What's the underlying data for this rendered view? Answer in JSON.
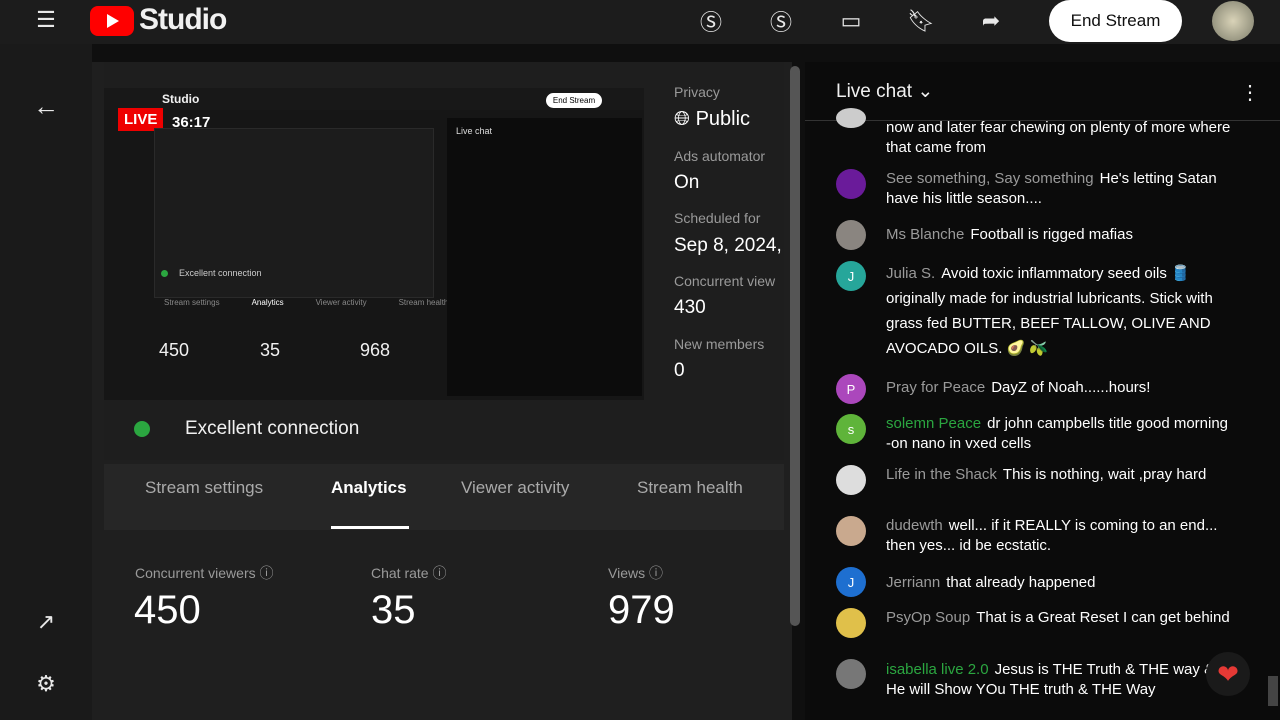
{
  "header": {
    "logo_text": "Studio",
    "end_stream": "End Stream",
    "icons": [
      "menu-icon",
      "youtube-logo",
      "super-chat-icon",
      "super-thanks-icon",
      "clapperboard-icon",
      "bookmark-icon",
      "share-icon"
    ]
  },
  "preview": {
    "live_badge": "LIVE",
    "elapsed": "36:17",
    "inner_logo": "Studio",
    "inner_end": "End Stream",
    "inner_chat_title": "Live chat",
    "inner_connection": "Excellent connection",
    "inner_tabs": [
      "Stream settings",
      "Analytics",
      "Viewer activity",
      "Stream health"
    ],
    "inner_stats": [
      "450",
      "35",
      "968"
    ]
  },
  "connection": {
    "status": "Excellent connection",
    "color": "#2ba640"
  },
  "details": {
    "privacy_label": "Privacy",
    "privacy_value": "Public",
    "ads_label": "Ads automator",
    "ads_value": "On",
    "scheduled_label": "Scheduled for",
    "scheduled_value": "Sep 8, 2024,",
    "concurrent_label": "Concurrent view",
    "concurrent_value": "430",
    "members_label": "New members",
    "members_value": "0"
  },
  "tabs": [
    {
      "label": "Stream settings"
    },
    {
      "label": "Analytics",
      "active": true
    },
    {
      "label": "Viewer activity"
    },
    {
      "label": "Stream health"
    }
  ],
  "stats": [
    {
      "label": "Concurrent viewers",
      "value": "450"
    },
    {
      "label": "Chat rate",
      "value": "35"
    },
    {
      "label": "Views",
      "value": "979"
    }
  ],
  "chat": {
    "title": "Live chat",
    "messages": [
      {
        "author": "",
        "text": "now and later fear chewing on plenty of more where that came from"
      },
      {
        "author": "See something, Say something",
        "text": "He's letting Satan have his little season...."
      },
      {
        "author": "Ms Blanche",
        "text": "Football is rigged mafias"
      },
      {
        "author": "Julia S.",
        "text": "Avoid toxic inflammatory seed oils 🛢️ originally made for industrial lubricants. Stick with grass fed BUTTER, BEEF TALLOW, OLIVE AND AVOCADO OILS. 🥑 🫒",
        "initial": "J"
      },
      {
        "author": "Pray for Peace",
        "text": "DayZ of Noah......hours!",
        "initial": "P"
      },
      {
        "author": "solemn Peace",
        "text": "dr john campbells title good morning -on nano in vxed cells",
        "initial": "s",
        "member": true
      },
      {
        "author": "Life in the Shack",
        "text": "This is nothing, wait ,pray hard"
      },
      {
        "author": "dudewth",
        "text": "well... if it REALLY is coming to an end... then yes... id be ecstatic."
      },
      {
        "author": "Jerriann",
        "text": "that already happened",
        "initial": "J"
      },
      {
        "author": "PsyOp Soup",
        "text": "That is a Great Reset I can get behind"
      },
      {
        "author": "isabella live 2.0",
        "text": "Jesus is THE Truth & THE way & He will Show YOu THE truth & THE Way",
        "member": true
      }
    ]
  }
}
